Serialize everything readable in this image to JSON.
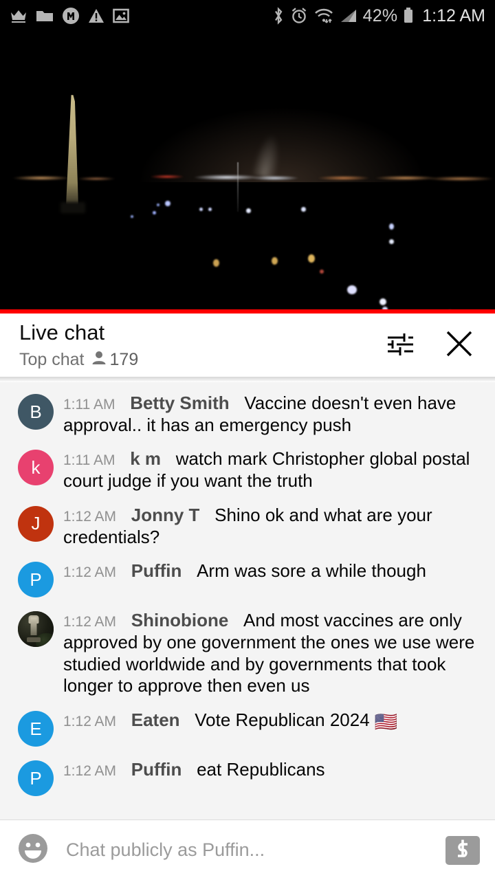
{
  "statusbar": {
    "left_icons": [
      "crown-icon",
      "folder-icon",
      "m-badge-icon",
      "warning-icon",
      "image-icon"
    ],
    "right_icons": [
      "bluetooth-icon",
      "alarm-icon",
      "wifi-icon",
      "cellular-signal-icon",
      "battery-icon"
    ],
    "battery_percent": "42%",
    "time": "1:12 AM"
  },
  "video": {
    "description": "Washington DC night skyline webcam with Washington Monument",
    "progress_percent": 100,
    "progress_color": "#ff0000"
  },
  "chat_header": {
    "title": "Live chat",
    "mode": "Top chat",
    "viewer_count": "179",
    "settings_icon": "tune-sliders-icon",
    "close_icon": "close-x-icon"
  },
  "messages": [
    {
      "time": "1:11 AM",
      "author": "Betty Smith",
      "text": "Vaccine doesn't even have approval.. it has an emergency push",
      "avatar_initial": "B",
      "avatar_color": "#3f5765",
      "avatar_type": "initial"
    },
    {
      "time": "1:11 AM",
      "author": "k m",
      "text": "watch mark Christopher global postal court judge if you want the truth",
      "avatar_initial": "k",
      "avatar_color": "#e8416f",
      "avatar_type": "initial"
    },
    {
      "time": "1:12 AM",
      "author": "Jonny T",
      "text": "Shino ok and what are your credentials?",
      "avatar_initial": "J",
      "avatar_color": "#c0330f",
      "avatar_type": "initial"
    },
    {
      "time": "1:12 AM",
      "author": "Puffin",
      "text": "Arm was sore a while though",
      "avatar_initial": "P",
      "avatar_color": "#1b9ae0",
      "avatar_type": "initial"
    },
    {
      "time": "1:12 AM",
      "author": "Shinobione",
      "text": "And most vaccines are only approved by one government the ones we use were studied worldwide and by governments that took longer to approve then even us",
      "avatar_initial": "",
      "avatar_color": "#14160f",
      "avatar_type": "photo"
    },
    {
      "time": "1:12 AM",
      "author": "Eaten",
      "text": "Vote Republican 2024 ",
      "emoji": "🇺🇸",
      "avatar_initial": "E",
      "avatar_color": "#1b9ae0",
      "avatar_type": "initial"
    },
    {
      "time": "1:12 AM",
      "author": "Puffin",
      "text": "eat Republicans",
      "avatar_initial": "P",
      "avatar_color": "#1b9ae0",
      "avatar_type": "initial"
    }
  ],
  "input_bar": {
    "emoji_icon": "smiley-face-icon",
    "placeholder": "Chat publicly as Puffin...",
    "value": "",
    "superchat_icon": "dollar-superchat-icon"
  }
}
